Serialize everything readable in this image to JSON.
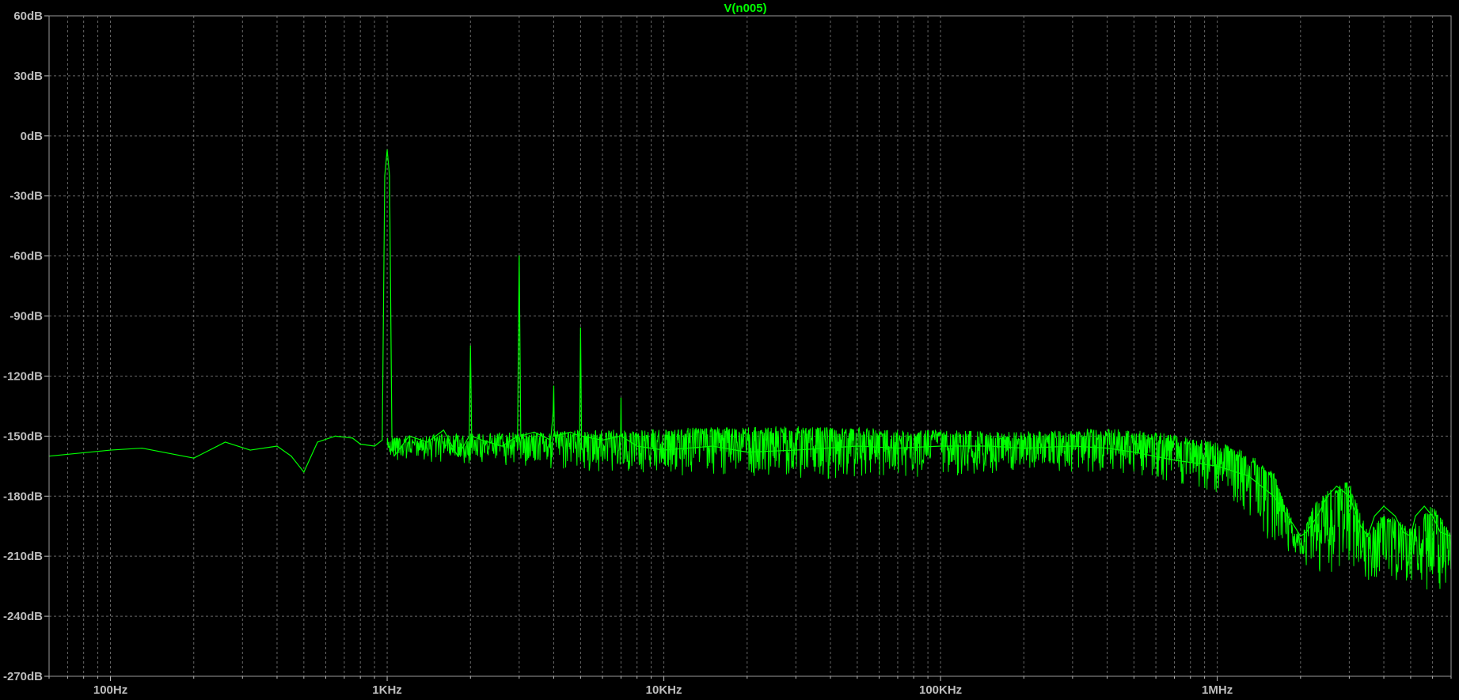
{
  "colors": {
    "background": "#000000",
    "trace": "#00ff00",
    "grid": "#8a8a8a",
    "labels": "#bdbdbd"
  },
  "chart_data": {
    "type": "line",
    "title": "V(n005)",
    "xscale": "log",
    "xlim": [
      60,
      7000000
    ],
    "ylim": [
      -270,
      60
    ],
    "grid": true,
    "x_ticks": [
      {
        "value": 100,
        "label": "100Hz"
      },
      {
        "value": 1000,
        "label": "1KHz"
      },
      {
        "value": 10000,
        "label": "10KHz"
      },
      {
        "value": 100000,
        "label": "100KHz"
      },
      {
        "value": 1000000,
        "label": "1MHz"
      }
    ],
    "y_ticks": [
      {
        "value": 60,
        "label": "60dB"
      },
      {
        "value": 30,
        "label": "30dB"
      },
      {
        "value": 0,
        "label": "0dB"
      },
      {
        "value": -30,
        "label": "-30dB"
      },
      {
        "value": -60,
        "label": "-60dB"
      },
      {
        "value": -90,
        "label": "-90dB"
      },
      {
        "value": -120,
        "label": "-120dB"
      },
      {
        "value": -150,
        "label": "-150dB"
      },
      {
        "value": -180,
        "label": "-180dB"
      },
      {
        "value": -210,
        "label": "-210dB"
      },
      {
        "value": -240,
        "label": "-240dB"
      },
      {
        "value": -270,
        "label": "-270dB"
      }
    ],
    "series": [
      {
        "name": "V(n005)",
        "x": [
          60,
          100,
          130,
          200,
          260,
          320,
          400,
          450,
          500,
          560,
          650,
          750,
          800,
          900,
          960,
          980,
          1000,
          1020,
          1040,
          1060,
          1200,
          1400,
          1600,
          1800,
          1980,
          2000,
          2020,
          2200,
          2600,
          2960,
          3000,
          3040,
          3400,
          3900,
          3980,
          4000,
          4020,
          4600,
          4960,
          5000,
          5040,
          6000,
          6980,
          7000,
          7020,
          8000,
          10000,
          15000,
          20000,
          30000,
          50000,
          70000,
          100000,
          150000,
          200000,
          300000,
          400000,
          500000,
          700000,
          1000000,
          1300000,
          1600000,
          1900000,
          2000000,
          2100000,
          2300000,
          2500000,
          2700000,
          3000000,
          3300000,
          3500000,
          3700000,
          4000000,
          4400000,
          4700000,
          5000000,
          5200000,
          5600000,
          6000000,
          6400000,
          7000000
        ],
        "y": [
          -160,
          -157,
          -156,
          -161,
          -153,
          -157,
          -155,
          -160,
          -168,
          -153,
          -150,
          -151,
          -154,
          -155,
          -152,
          -20,
          -7,
          -20,
          -150,
          -160,
          -150,
          -153,
          -147,
          -160,
          -150,
          -105,
          -150,
          -152,
          -155,
          -150,
          -60,
          -150,
          -148,
          -152,
          -138,
          -125,
          -150,
          -148,
          -150,
          -96,
          -150,
          -152,
          -150,
          -131,
          -150,
          -155,
          -157,
          -155,
          -158,
          -157,
          -155,
          -156,
          -155,
          -155,
          -156,
          -155,
          -156,
          -158,
          -162,
          -165,
          -170,
          -180,
          -195,
          -200,
          -198,
          -190,
          -180,
          -175,
          -180,
          -195,
          -200,
          -190,
          -185,
          -190,
          -198,
          -200,
          -190,
          -185,
          -190,
          -198,
          -200
        ]
      }
    ],
    "noise_band": {
      "x": [
        1000,
        3000,
        10000,
        30000,
        100000,
        200000,
        300000,
        400000,
        500000,
        700000,
        1000000,
        1300000,
        1600000,
        1900000,
        2000000,
        2300000,
        3000000,
        3500000,
        4000000,
        5000000,
        6000000,
        7000000
      ],
      "upper": [
        -150,
        -148,
        -146,
        -145,
        -147,
        -148,
        -147,
        -146,
        -147,
        -149,
        -153,
        -158,
        -168,
        -195,
        -198,
        -180,
        -172,
        -198,
        -188,
        -196,
        -184,
        -198
      ],
      "lower": [
        -162,
        -165,
        -170,
        -172,
        -170,
        -168,
        -168,
        -168,
        -170,
        -173,
        -178,
        -190,
        -205,
        -215,
        -212,
        -220,
        -218,
        -222,
        -220,
        -225,
        -228,
        -232
      ]
    }
  }
}
